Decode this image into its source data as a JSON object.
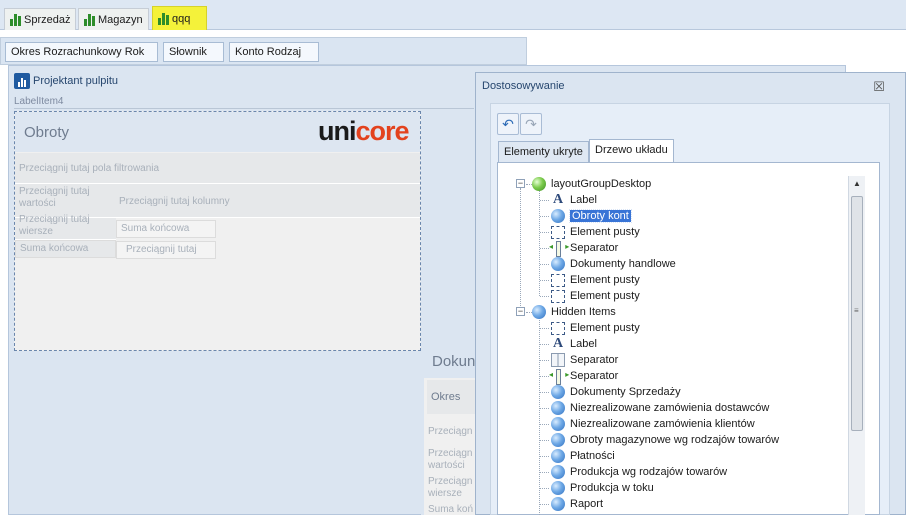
{
  "ribbon": {
    "tabs": [
      {
        "label": "Sprzedaż",
        "icon": "bar-chart-icon",
        "highlighted": false
      },
      {
        "label": "Magazyn",
        "icon": "bar-chart-icon",
        "highlighted": false
      },
      {
        "label": "qqq",
        "icon": "bar-chart-icon",
        "highlighted": true
      }
    ]
  },
  "toolbar": {
    "buttons": [
      "Okres Rozrachunkowy Rok",
      "Słownik",
      "Konto Rodzaj"
    ]
  },
  "designer": {
    "title": "Projektant pulpitu",
    "label_item": "LabelItem4"
  },
  "obroty": {
    "title": "Obroty",
    "logo_part1": "uni",
    "logo_part2": "core",
    "filter_placeholder": "Przeciągnij tutaj pola filtrowania",
    "values_placeholder": "Przeciągnij tutaj wartości",
    "columns_placeholder": "Przeciągnij tutaj kolumny",
    "rows_placeholder": "Przeciągnij tutaj wiersze",
    "grand_total_1": "Suma końcowa",
    "grand_total_2": "Suma końcowa",
    "drag_here": "Przeciągnij tutaj"
  },
  "dokumenty": {
    "title": "Dokun",
    "okres": "Okres",
    "t1": "Przeciągn",
    "t2a": "Przeciągn",
    "t2b": "wartości",
    "t3a": "Przeciągn",
    "t3b": "wiersze",
    "t4": "Suma koń"
  },
  "dialog": {
    "title": "Dostosowywanie",
    "close": "☒",
    "undo": "↶",
    "redo": "↷",
    "tabs": [
      "Elementy ukryte",
      "Drzewo układu"
    ],
    "active_tab": 1
  },
  "tree": {
    "root1": "layoutGroupDesktop",
    "root1_toggle": "−",
    "group1": [
      {
        "icon": "label",
        "label": "Label"
      },
      {
        "icon": "globe",
        "label": "Obroty kont",
        "selected": true
      },
      {
        "icon": "empty",
        "label": "Element pusty"
      },
      {
        "icon": "separator",
        "label": "Separator"
      },
      {
        "icon": "globe",
        "label": "Dokumenty handlowe"
      },
      {
        "icon": "empty",
        "label": "Element pusty"
      },
      {
        "icon": "empty",
        "label": "Element pusty"
      }
    ],
    "root2": "Hidden Items",
    "root2_toggle": "−",
    "group2": [
      {
        "icon": "empty",
        "label": "Element pusty"
      },
      {
        "icon": "label",
        "label": "Label"
      },
      {
        "icon": "separator-bar",
        "label": "Separator"
      },
      {
        "icon": "separator",
        "label": "Separator"
      },
      {
        "icon": "globe",
        "label": "Dokumenty Sprzedaży"
      },
      {
        "icon": "globe",
        "label": "Niezrealizowane zamówienia dostawców"
      },
      {
        "icon": "globe",
        "label": "Niezrealizowane zamówienia klientów"
      },
      {
        "icon": "globe",
        "label": "Obroty magazynowe wg rodzajów towarów"
      },
      {
        "icon": "globe",
        "label": "Płatności"
      },
      {
        "icon": "globe",
        "label": "Produkcja wg rodzajów towarów"
      },
      {
        "icon": "globe",
        "label": "Produkcja w toku"
      },
      {
        "icon": "globe",
        "label": "Raport"
      }
    ]
  },
  "scrollbar": {
    "up": "▲",
    "down": "▼",
    "grip": "≡"
  },
  "colors": {
    "highlight_tab": "#f4f23a",
    "selection": "#3874d6",
    "panel": "#dbe5f1",
    "logo_accent": "#e3421d"
  }
}
